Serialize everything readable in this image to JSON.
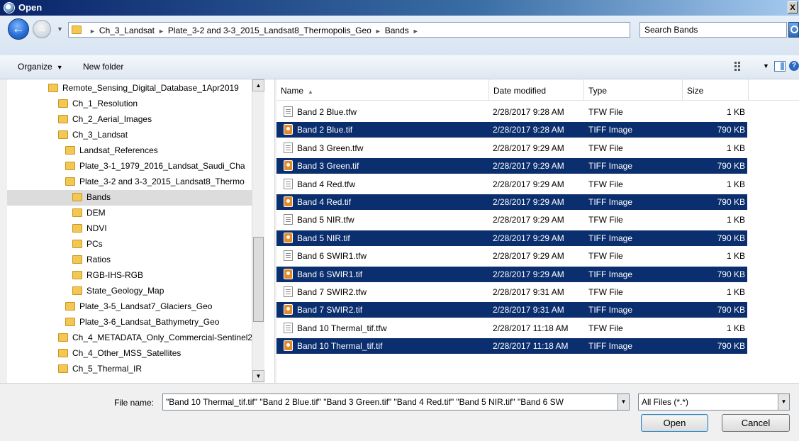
{
  "window": {
    "title": "Open",
    "close_glyph": "X"
  },
  "address": {
    "crumbs": [
      "Ch_3_Landsat",
      "Plate_3-2 and 3-3_2015_Landsat8_Thermopolis_Geo",
      "Bands"
    ],
    "search_placeholder": "Search Bands"
  },
  "toolbar": {
    "organize_label": "Organize",
    "new_folder_label": "New folder"
  },
  "tree": {
    "items": [
      {
        "label": "Remote_Sensing_Digital_Database_1Apr2019",
        "level": 0
      },
      {
        "label": "Ch_1_Resolution",
        "level": 1
      },
      {
        "label": "Ch_2_Aerial_Images",
        "level": 1
      },
      {
        "label": "Ch_3_Landsat",
        "level": 1
      },
      {
        "label": "Landsat_References",
        "level": 2
      },
      {
        "label": "Plate_3-1_1979_2016_Landsat_Saudi_Cha",
        "level": 2
      },
      {
        "label": "Plate_3-2 and 3-3_2015_Landsat8_Thermo",
        "level": 2
      },
      {
        "label": "Bands",
        "level": 3,
        "selected": true
      },
      {
        "label": "DEM",
        "level": 3
      },
      {
        "label": "NDVI",
        "level": 3
      },
      {
        "label": "PCs",
        "level": 3
      },
      {
        "label": "Ratios",
        "level": 3
      },
      {
        "label": "RGB-IHS-RGB",
        "level": 3
      },
      {
        "label": "State_Geology_Map",
        "level": 3
      },
      {
        "label": "Plate_3-5_Landsat7_Glaciers_Geo",
        "level": 2
      },
      {
        "label": "Plate_3-6_Landsat_Bathymetry_Geo",
        "level": 2
      },
      {
        "label": "Ch_4_METADATA_Only_Commercial-Sentinel2",
        "level": 1
      },
      {
        "label": "Ch_4_Other_MSS_Satellites",
        "level": 1
      },
      {
        "label": "Ch_5_Thermal_IR",
        "level": 1
      }
    ]
  },
  "files": {
    "columns": [
      "Name",
      "Date modified",
      "Type",
      "Size"
    ],
    "rows": [
      {
        "name": "Band 2 Blue.tfw",
        "date": "2/28/2017 9:28 AM",
        "type": "TFW File",
        "size": "1 KB",
        "kind": "tfw",
        "selected": false
      },
      {
        "name": "Band 2 Blue.tif",
        "date": "2/28/2017 9:28 AM",
        "type": "TIFF Image",
        "size": "790 KB",
        "kind": "tif",
        "selected": true
      },
      {
        "name": "Band 3 Green.tfw",
        "date": "2/28/2017 9:29 AM",
        "type": "TFW File",
        "size": "1 KB",
        "kind": "tfw",
        "selected": false
      },
      {
        "name": "Band 3 Green.tif",
        "date": "2/28/2017 9:29 AM",
        "type": "TIFF Image",
        "size": "790 KB",
        "kind": "tif",
        "selected": true
      },
      {
        "name": "Band 4 Red.tfw",
        "date": "2/28/2017 9:29 AM",
        "type": "TFW File",
        "size": "1 KB",
        "kind": "tfw",
        "selected": false
      },
      {
        "name": "Band 4 Red.tif",
        "date": "2/28/2017 9:29 AM",
        "type": "TIFF Image",
        "size": "790 KB",
        "kind": "tif",
        "selected": true
      },
      {
        "name": "Band 5 NIR.tfw",
        "date": "2/28/2017 9:29 AM",
        "type": "TFW File",
        "size": "1 KB",
        "kind": "tfw",
        "selected": false
      },
      {
        "name": "Band 5 NIR.tif",
        "date": "2/28/2017 9:29 AM",
        "type": "TIFF Image",
        "size": "790 KB",
        "kind": "tif",
        "selected": true
      },
      {
        "name": "Band 6 SWIR1.tfw",
        "date": "2/28/2017 9:29 AM",
        "type": "TFW File",
        "size": "1 KB",
        "kind": "tfw",
        "selected": false
      },
      {
        "name": "Band 6 SWIR1.tif",
        "date": "2/28/2017 9:29 AM",
        "type": "TIFF Image",
        "size": "790 KB",
        "kind": "tif",
        "selected": true
      },
      {
        "name": "Band 7 SWIR2.tfw",
        "date": "2/28/2017 9:31 AM",
        "type": "TFW File",
        "size": "1 KB",
        "kind": "tfw",
        "selected": false
      },
      {
        "name": "Band 7 SWIR2.tif",
        "date": "2/28/2017 9:31 AM",
        "type": "TIFF Image",
        "size": "790 KB",
        "kind": "tif",
        "selected": true
      },
      {
        "name": "Band 10 Thermal_tif.tfw",
        "date": "2/28/2017 11:18 AM",
        "type": "TFW File",
        "size": "1 KB",
        "kind": "tfw",
        "selected": false
      },
      {
        "name": "Band 10 Thermal_tif.tif",
        "date": "2/28/2017 11:18 AM",
        "type": "TIFF Image",
        "size": "790 KB",
        "kind": "tif",
        "selected": true
      }
    ]
  },
  "bottom": {
    "file_name_label": "File name:",
    "file_name_value": "\"Band 10 Thermal_tif.tif\" \"Band 2 Blue.tif\" \"Band 3 Green.tif\" \"Band 4 Red.tif\" \"Band 5 NIR.tif\" \"Band 6 SW",
    "file_type_value": "All Files (*.*)",
    "open_label": "Open",
    "cancel_label": "Cancel"
  },
  "colors": {
    "selection": "#0a2e6e",
    "titlebar": "#0a246a"
  }
}
